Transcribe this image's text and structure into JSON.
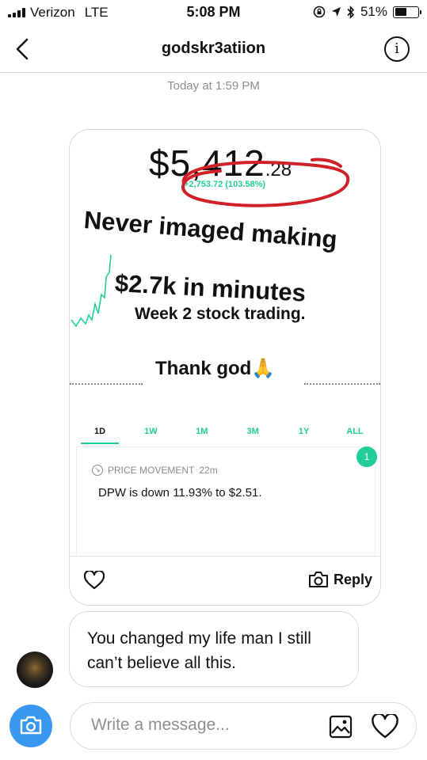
{
  "status_bar": {
    "carrier": "Verizon",
    "network": "LTE",
    "time": "5:08 PM",
    "battery": "51%",
    "battery_level": 0.51,
    "icons": [
      "signal-icon",
      "lock-rotation-icon",
      "location-icon",
      "bluetooth-icon",
      "battery-icon"
    ]
  },
  "header": {
    "title": "godskr3atiion",
    "back_icon": "chevron-left-icon",
    "info_icon": "info-icon"
  },
  "thread": {
    "timestamp": "Today at 1:59 PM",
    "story_reply": {
      "price_main": "$5,412",
      "price_cents": ".28",
      "change": "+2,753.72 (103.58%)",
      "overlay_line1": "Never imaged making",
      "overlay_line2": "$2.7k in minutes",
      "overlay_line3": "Week 2 stock trading.",
      "overlay_line4": "Thank god",
      "emoji": "🙏",
      "ranges": [
        "1D",
        "1W",
        "1M",
        "3M",
        "1Y",
        "ALL"
      ],
      "active_range": "1D",
      "badge_count": "1",
      "news_label": "PRICE MOVEMENT",
      "news_age": "22m",
      "news_text": "DPW is down 11.93% to $2.51.",
      "reply_label": "Reply"
    },
    "incoming_message": "You changed my life man I still can’t believe all this."
  },
  "composer": {
    "placeholder": "Write a message...",
    "icons": [
      "camera-icon",
      "gallery-icon",
      "heart-icon"
    ]
  },
  "colors": {
    "accent_green": "#21ce99",
    "circle_red": "#d0202a",
    "camera_blue": "#3897f0"
  }
}
